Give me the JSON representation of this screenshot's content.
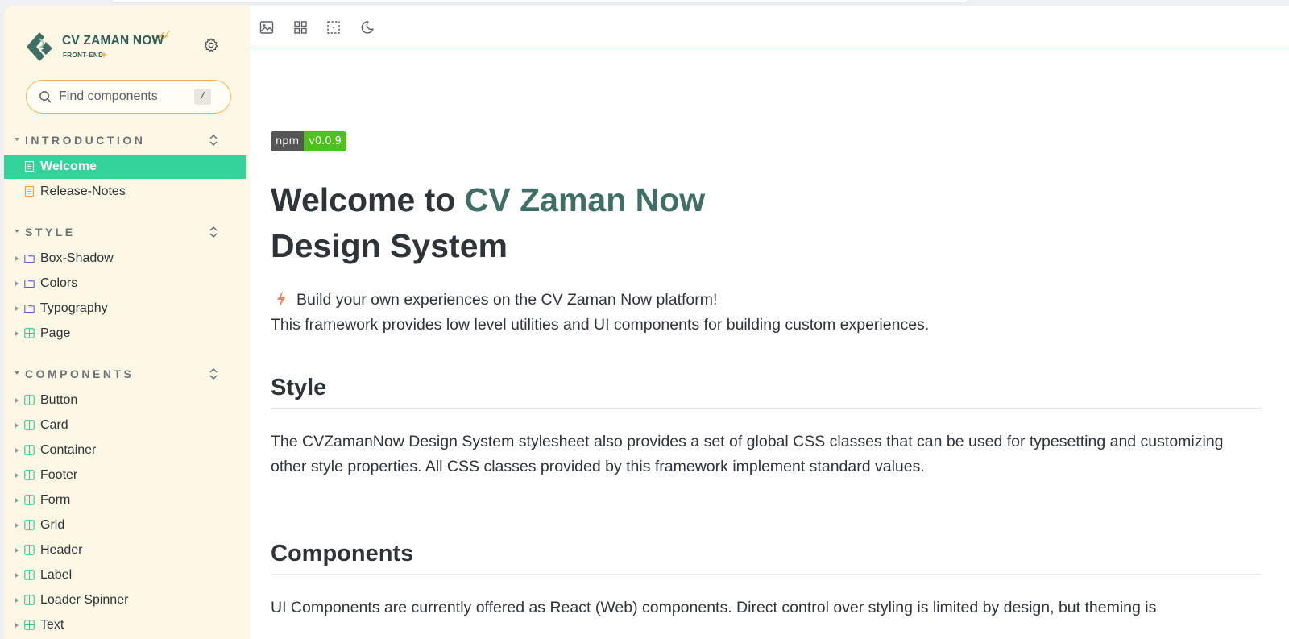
{
  "brand": {
    "title": "CV ZAMAN NOW",
    "subtitle": "FRONT-END",
    "settings_icon": "gear-icon"
  },
  "search": {
    "placeholder": "Find components",
    "shortcut": "/"
  },
  "sidebar": {
    "sections": [
      {
        "label": "INTRODUCTION"
      },
      {
        "label": "STYLE"
      },
      {
        "label": "COMPONENTS"
      }
    ],
    "introduction_items": [
      {
        "label": "Welcome",
        "icon": "document-icon",
        "active": true
      },
      {
        "label": "Release-Notes",
        "icon": "document-icon",
        "active": false
      }
    ],
    "style_items": [
      {
        "label": "Box-Shadow",
        "icon": "folder-icon"
      },
      {
        "label": "Colors",
        "icon": "folder-icon"
      },
      {
        "label": "Typography",
        "icon": "folder-icon"
      },
      {
        "label": "Page",
        "icon": "component-icon"
      }
    ],
    "component_items": [
      {
        "label": "Button",
        "icon": "component-icon"
      },
      {
        "label": "Card",
        "icon": "component-icon"
      },
      {
        "label": "Container",
        "icon": "component-icon"
      },
      {
        "label": "Footer",
        "icon": "component-icon"
      },
      {
        "label": "Form",
        "icon": "component-icon"
      },
      {
        "label": "Grid",
        "icon": "component-icon"
      },
      {
        "label": "Header",
        "icon": "component-icon"
      },
      {
        "label": "Label",
        "icon": "component-icon"
      },
      {
        "label": "Loader Spinner",
        "icon": "component-icon"
      },
      {
        "label": "Text",
        "icon": "component-icon"
      }
    ]
  },
  "toolbar": {
    "tools": [
      "image-icon",
      "grid-icon",
      "outline-icon",
      "moon-icon"
    ]
  },
  "content": {
    "badge_left": "npm",
    "badge_right": "v0.0.9",
    "title_part1": "Welcome to ",
    "title_accent": "CV Zaman Now",
    "title_line2": "Design System",
    "lead_line1": "Build your own experiences on the CV Zaman Now platform!",
    "lead_line2": "This framework provides low level utilities and UI components for building custom experiences.",
    "style_heading": "Style",
    "style_text": "The CVZamanNow Design System stylesheet also provides a set of global CSS classes that can be used for typesetting and customizing other style properties. All CSS classes provided by this framework implement standard values.",
    "components_heading": "Components",
    "components_text": "UI Components are currently offered as React (Web) components. Direct control over styling is limited by design, but theming is"
  },
  "colors": {
    "sidebar_bg": "#fdf8e6",
    "active_item": "#34d399",
    "accent_text": "#3e6e64",
    "search_border": "#f0b94a",
    "folder_icon": "#6a5acd",
    "component_icon": "#34c38f",
    "document_icon": "#f0a040"
  }
}
